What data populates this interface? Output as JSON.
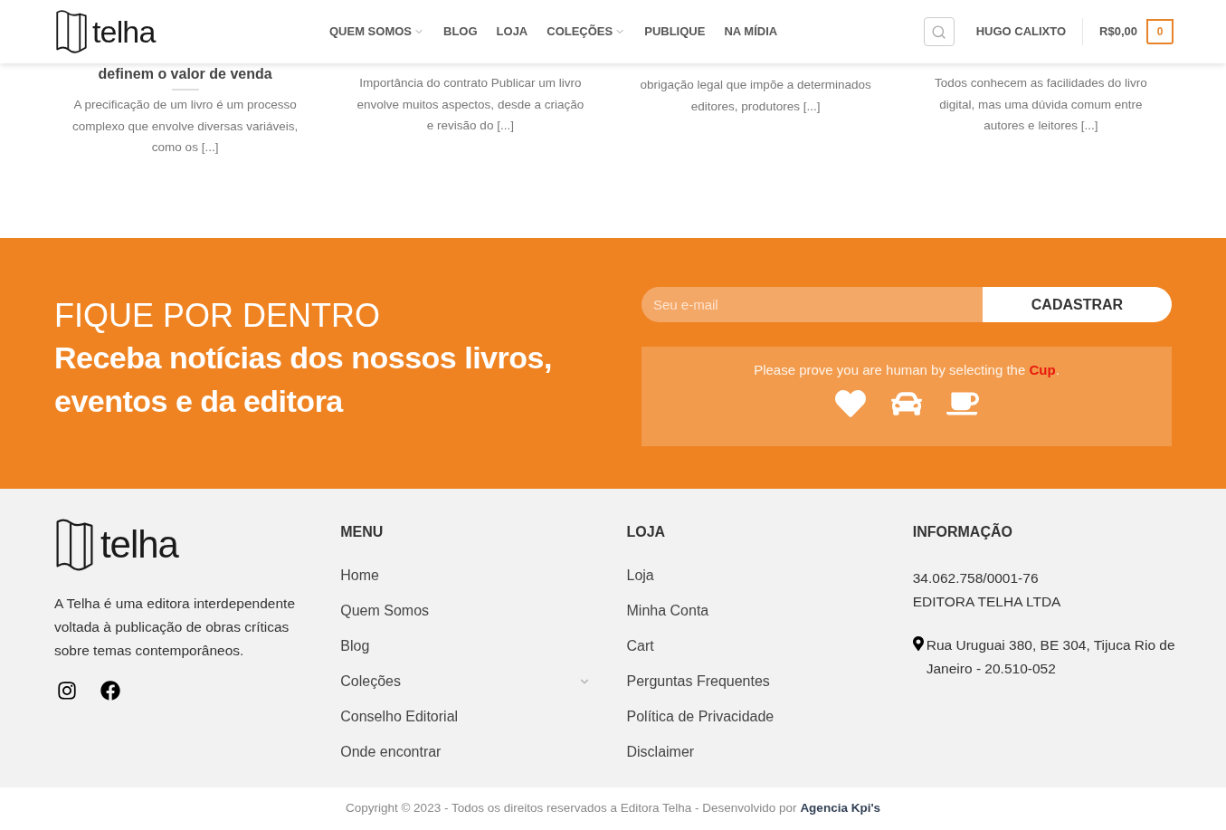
{
  "header": {
    "logo": "telha",
    "nav": [
      {
        "label": "QUEM SOMOS",
        "dropdown": true
      },
      {
        "label": "BLOG",
        "dropdown": false
      },
      {
        "label": "LOJA",
        "dropdown": false
      },
      {
        "label": "COLEÇÕES",
        "dropdown": true
      },
      {
        "label": "PUBLIQUE",
        "dropdown": false
      },
      {
        "label": "NA MÍDIA",
        "dropdown": false
      }
    ],
    "account": "HUGO CALIXTO",
    "cart_total": "R$0,00",
    "cart_count": "0"
  },
  "posts": [
    {
      "title": "definem o valor de venda",
      "excerpt": "A precificação de um livro é um processo complexo que envolve diversas variáveis, como os [...]"
    },
    {
      "excerpt": "Importância do contrato Publicar um livro envolve muitos aspectos, desde a criação e revisão do [...]"
    },
    {
      "excerpt": "obrigação legal que impõe a determinados editores, produtores [...]"
    },
    {
      "excerpt": "Todos conhecem as facilidades do livro digital, mas uma dúvida comum entre autores e leitores [...]"
    }
  ],
  "newsletter": {
    "heading": "FIQUE POR DENTRO",
    "subheading": "Receba notícias dos nossos livros, eventos e da editora",
    "email_placeholder": "Seu e-mail",
    "button": "CADASTRAR",
    "captcha": {
      "prompt": "Please prove you are human by selecting the",
      "target": "Cup",
      "end": ".",
      "options": [
        {
          "kind": "heart"
        },
        {
          "kind": "car"
        },
        {
          "kind": "cup"
        }
      ]
    }
  },
  "footer": {
    "logo": "telha",
    "about": "A Telha é uma editora interdependente voltada à publicação de obras críticas sobre temas contemporâneos.",
    "social": [
      {
        "kind": "instagram"
      },
      {
        "kind": "facebook"
      }
    ],
    "menu": {
      "title": "MENU",
      "items": [
        {
          "label": "Home",
          "expandable": false
        },
        {
          "label": "Quem Somos",
          "expandable": false
        },
        {
          "label": "Blog",
          "expandable": false
        },
        {
          "label": "Coleções",
          "expandable": true
        },
        {
          "label": "Conselho Editorial",
          "expandable": false
        },
        {
          "label": "Onde encontrar",
          "expandable": false
        }
      ]
    },
    "shop": {
      "title": "LOJA",
      "items": [
        "Loja",
        "Minha Conta",
        "Cart",
        "Perguntas Frequentes",
        "Política de Privacidade",
        "Disclaimer"
      ]
    },
    "info": {
      "title": "INFORMAÇÃO",
      "lines": [
        "34.062.758/0001-76",
        "EDITORA TELHA LTDA"
      ],
      "address": "Rua Uruguai 380, BE 304, Tijuca Rio de Janeiro - 20.510-052"
    },
    "copyright": "Copyright © 2023 - Todos os direitos reservados a Editora Telha - Desenvolvido por",
    "credit": "Agencia Kpi's"
  }
}
